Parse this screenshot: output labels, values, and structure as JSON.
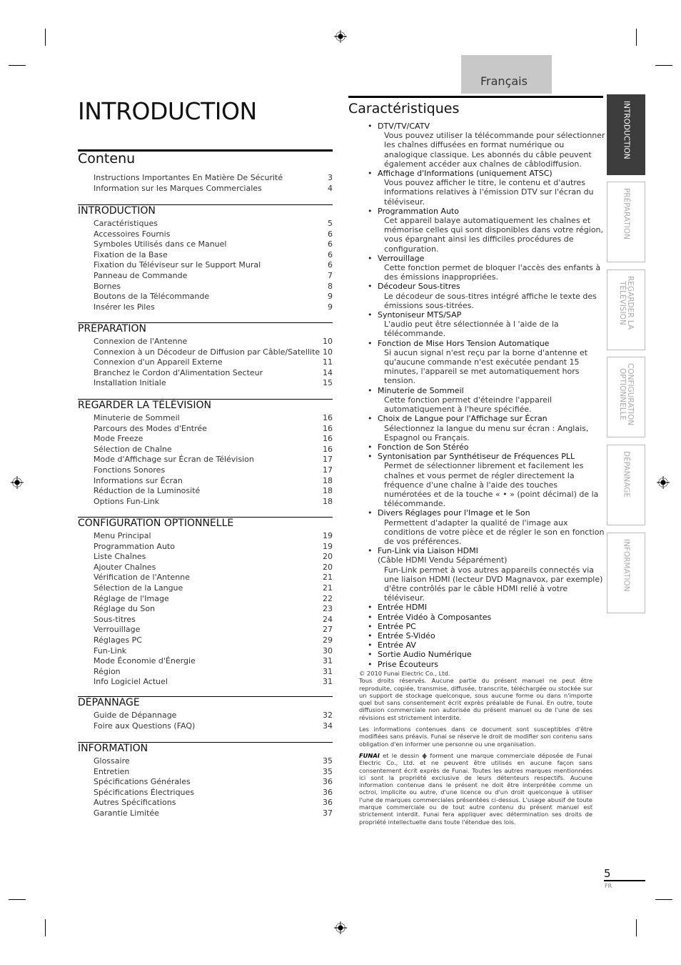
{
  "language_tab": "Français",
  "page_title": "INTRODUCTION",
  "contents": {
    "heading": "Contenu",
    "intro_items": [
      {
        "label": "Instructions Importantes En Matière De Sécurité",
        "page": "3"
      },
      {
        "label": "Information sur les Marques Commerciales",
        "page": "4"
      }
    ],
    "sections": [
      {
        "title": "INTRODUCTION",
        "items": [
          {
            "label": "Caractéristiques",
            "page": "5"
          },
          {
            "label": "Accessoires Fournis",
            "page": "6"
          },
          {
            "label": "Symboles Utilisés dans ce Manuel",
            "page": "6"
          },
          {
            "label": "Fixation de la Base",
            "page": "6"
          },
          {
            "label": "Fixation du Téléviseur sur le Support Mural",
            "page": "6"
          },
          {
            "label": "Panneau de Commande",
            "page": "7"
          },
          {
            "label": "Bornes",
            "page": "8"
          },
          {
            "label": "Boutons de la Télécommande",
            "page": "9"
          },
          {
            "label": "Insérer les Piles",
            "page": "9"
          }
        ]
      },
      {
        "title": "PRÉPARATION",
        "items": [
          {
            "label": "Connexion de l'Antenne",
            "page": "10"
          },
          {
            "label": "Connexion à un Décodeur de Diffusion par Câble/Satellite",
            "page": "10"
          },
          {
            "label": "Connexion d'un Appareil Externe",
            "page": "11"
          },
          {
            "label": "Branchez le Cordon d'Alimentation Secteur",
            "page": "14"
          },
          {
            "label": "Installation Initiale",
            "page": "15"
          }
        ]
      },
      {
        "title": "REGARDER LA TÉLÉVISION",
        "items": [
          {
            "label": "Minuterie de Sommeil",
            "page": "16"
          },
          {
            "label": "Parcours des Modes d'Entrée",
            "page": "16"
          },
          {
            "label": "Mode Freeze",
            "page": "16"
          },
          {
            "label": "Sélection de Chaîne",
            "page": "16"
          },
          {
            "label": "Mode d'Affichage sur Écran de Télévision",
            "page": "17"
          },
          {
            "label": "Fonctions Sonores",
            "page": "17"
          },
          {
            "label": "Informations sur Écran",
            "page": "18"
          },
          {
            "label": "Réduction de la Luminosité",
            "page": "18"
          },
          {
            "label": "Options Fun-Link",
            "page": "18"
          }
        ]
      },
      {
        "title": "CONFIGURATION OPTIONNELLE",
        "items": [
          {
            "label": "Menu Principal",
            "page": "19"
          },
          {
            "label": "Programmation Auto",
            "page": "19"
          },
          {
            "label": "Liste Chaînes",
            "page": "20"
          },
          {
            "label": "Ajouter Chaînes",
            "page": "20"
          },
          {
            "label": "Vérification de l'Antenne",
            "page": "21"
          },
          {
            "label": "Sélection de la Langue",
            "page": "21"
          },
          {
            "label": "Réglage de l'Image",
            "page": "22"
          },
          {
            "label": "Réglage du Son",
            "page": "23"
          },
          {
            "label": "Sous-titres",
            "page": "24"
          },
          {
            "label": "Verrouillage",
            "page": "27"
          },
          {
            "label": "Réglages PC",
            "page": "29"
          },
          {
            "label": "Fun-Link",
            "page": "30"
          },
          {
            "label": "Mode Économie d'Énergie",
            "page": "31"
          },
          {
            "label": "Région",
            "page": "31"
          },
          {
            "label": "Info Logiciel Actuel",
            "page": "31"
          }
        ]
      },
      {
        "title": "DÉPANNAGE",
        "items": [
          {
            "label": "Guide de Dépannage",
            "page": "32"
          },
          {
            "label": "Foire aux Questions (FAQ)",
            "page": "34"
          }
        ]
      },
      {
        "title": "INFORMATION",
        "items": [
          {
            "label": "Glossaire",
            "page": "35"
          },
          {
            "label": "Entretien",
            "page": "35"
          },
          {
            "label": "Spécifications Générales",
            "page": "36"
          },
          {
            "label": "Spécifications Électriques",
            "page": "36"
          },
          {
            "label": "Autres Spécifications",
            "page": "36"
          },
          {
            "label": "Garantie Limitée",
            "page": "37"
          }
        ]
      }
    ]
  },
  "features": {
    "heading": "Caractéristiques",
    "items": [
      {
        "title": "DTV/TV/CATV",
        "desc": "Vous pouvez utiliser la télécommande pour sélectionner les chaînes diffusées en format numérique ou analogique classique. Les abonnés du câble peuvent également accéder aux chaînes de câblodiffusion."
      },
      {
        "title": "Affichage d'Informations (uniquement ATSC)",
        "desc": "Vous pouvez afficher le titre, le contenu et d'autres informations relatives à l'émission DTV sur l'écran du téléviseur."
      },
      {
        "title": "Programmation Auto",
        "desc": "Cet appareil balaye automatiquement les chaînes et mémorise celles qui sont disponibles dans votre région, vous épargnant ainsi les difficiles procédures de configuration."
      },
      {
        "title": "Verrouillage",
        "desc": "Cette fonction permet de bloquer l'accès des enfants à des émissions inappropriées."
      },
      {
        "title": "Décodeur Sous-titres",
        "desc": "Le décodeur de sous-titres intégré affiche le texte des émissions sous-titrées."
      },
      {
        "title": "Syntoniseur MTS/SAP",
        "desc": "L'audio peut être sélectionnée à l 'aide de la télécommande."
      },
      {
        "title": "Fonction de Mise Hors Tension Automatique",
        "desc": "Si aucun signal n'est reçu par la borne d'antenne et qu'aucune commande n'est exécutée pendant 15 minutes, l'appareil se met automatiquement hors tension."
      },
      {
        "title": "Minuterie de Sommeil",
        "desc": "Cette fonction permet d'éteindre l'appareil automatiquement à l'heure spécifiée."
      },
      {
        "title": "Choix de Langue pour l'Affichage sur Écran",
        "desc": "Sélectionnez la langue du menu sur écran : Anglais, Espagnol ou Français."
      },
      {
        "title": "Fonction de Son Stéréo",
        "desc": ""
      },
      {
        "title": "Syntonisation par Synthétiseur de Fréquences PLL",
        "desc": "Permet de sélectionner librement et facilement les chaînes et vous permet de régler directement la fréquence d'une chaîne à l'aide des touches numérotées et de la touche « • » (point décimal) de la télécommande."
      },
      {
        "title": "Divers Réglages pour l'Image et le Son",
        "desc": "Permettent d'adapter la qualité de l'image aux conditions de votre pièce et de régler le son en fonction de vos préférences."
      },
      {
        "title": "Fun-Link via Liaison HDMI",
        "sub": "(Câble HDMI Vendu Séparément)",
        "desc": "Fun-Link permet à vos autres appareils connectés via une liaison HDMI (lecteur DVD Magnavox, par exemple) d'être contrôlés par le câble HDMI relié à votre téléviseur."
      },
      {
        "title": "Entrée HDMI",
        "desc": ""
      },
      {
        "title": "Entrée Vidéo à Composantes",
        "desc": ""
      },
      {
        "title": "Entrée PC",
        "desc": ""
      },
      {
        "title": "Entrée S-Vidéo",
        "desc": ""
      },
      {
        "title": "Entrée AV",
        "desc": ""
      },
      {
        "title": "Sortie Audio Numérique",
        "desc": ""
      },
      {
        "title": "Prise Écouteurs",
        "desc": ""
      }
    ]
  },
  "legal": {
    "copyright": "© 2010 Funai Electric Co., Ltd.",
    "p1": "Tous droits réservés. Aucune partie du présent manuel ne peut être reproduite, copiée, transmise, diffusée, transcrite, téléchargée ou stockée sur un support de stockage quelconque, sous aucune forme ou dans n'importe quel but sans consentement écrit exprès préalable de Funai. En outre, toute diffusion commerciale non autorisée du présent manuel ou de l'une de ses révisions est strictement interdite.",
    "p2": "Les informations contenues dans ce document sont susceptibles d'être modifiées sans préavis. Funai se réserve le droit de modifier son contenu sans obligation d'en informer une personne ou une organisation.",
    "logo_text": "FUNAI",
    "p3_a": " et le dessin ",
    "p3_b": " forment une marque commerciale déposée de Funai Electric Co., Ltd. et ne peuvent être utilisés en aucune façon sans consentement écrit exprès de Funai. Toutes les autres marques mentionnées ici sont la propriété exclusive de leurs détenteurs respectifs. Aucune information contenue dans le présent ne doit être interprétée comme un octroi, implicite ou autre, d'une licence ou d'un droit quelconque à utiliser l'une de marques commerciales présentées ci-dessus. L'usage abusif de toute marque commerciale ou de tout autre contenu du présent manuel est strictement interdit. Funai fera appliquer avec détermination ses droits de propriété intellectuelle dans toute l'étendue des lois."
  },
  "side_tabs": [
    {
      "label": "INTRODUCTION",
      "active": true
    },
    {
      "label": "PRÉPARATION",
      "active": false
    },
    {
      "label": "REGARDER LA\nTÉLÉVISION",
      "active": false
    },
    {
      "label": "CONFIGURATION\nOPTIONNELLE",
      "active": false
    },
    {
      "label": "DÉPANNAGE",
      "active": false
    },
    {
      "label": "INFORMATION",
      "active": false
    }
  ],
  "footer": {
    "page_number": "5",
    "lang_code": "FR"
  }
}
